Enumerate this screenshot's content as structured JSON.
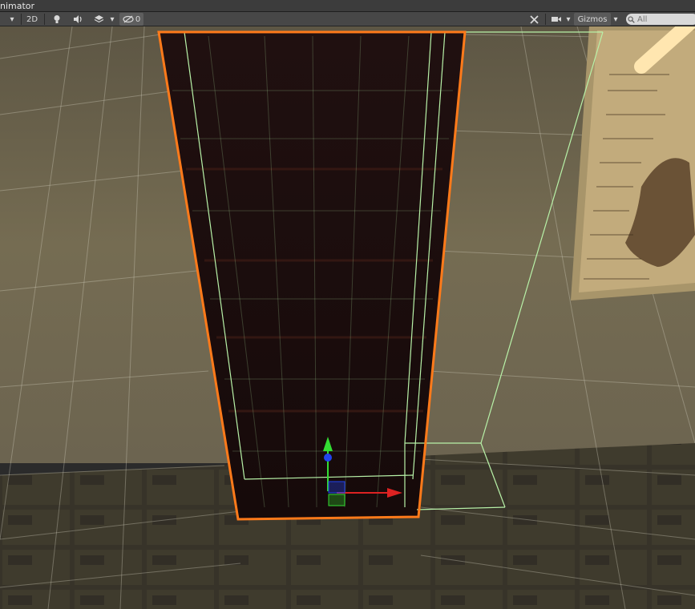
{
  "window": {
    "tab_label": "nimator"
  },
  "toolbar": {
    "shading_mode_arrow": "▾",
    "mode_2d_label": "2D",
    "lighting_icon": "lightbulb-icon",
    "audio_icon": "speaker-icon",
    "effects_icon": "layers-icon",
    "effects_arrow": "▾",
    "hidden_count": "0",
    "hidden_icon": "eye-slash-icon",
    "tools_icon": "tools-icon",
    "camera_icon": "camera-icon",
    "camera_arrow": "▾",
    "gizmos_label": "Gizmos",
    "gizmos_arrow": "▾",
    "search_placeholder": "All"
  },
  "colors": {
    "selection_outline": "#ff7a1a",
    "bounds_wireframe": "#b8f2a8",
    "axis_y": "#33dd33",
    "axis_x": "#dd2222",
    "axis_z": "#2244ee",
    "wall": "#6a6149",
    "floor": "#3d3a2f"
  }
}
